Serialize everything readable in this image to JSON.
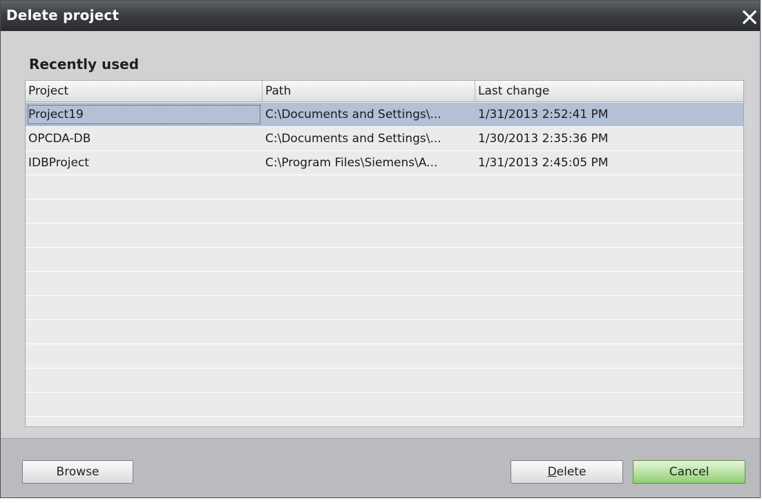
{
  "window": {
    "title": "Delete project"
  },
  "section": {
    "title": "Recently used"
  },
  "table": {
    "columns": [
      "Project",
      "Path",
      "Last change"
    ],
    "rows": [
      {
        "project": "Project19",
        "path": "C:\\Documents and Settings\\...",
        "last_change": "1/31/2013 2:52:41 PM",
        "selected": true
      },
      {
        "project": "OPCDA-DB",
        "path": "C:\\Documents and Settings\\...",
        "last_change": "1/30/2013 2:35:36 PM",
        "selected": false
      },
      {
        "project": "IDBProject",
        "path": "C:\\Program Files\\Siemens\\A...",
        "last_change": "1/31/2013 2:45:05 PM",
        "selected": false
      }
    ]
  },
  "buttons": {
    "browse": "Browse",
    "delete_mnemonic": "D",
    "delete_rest": "elete",
    "cancel": "Cancel"
  },
  "icons": {
    "close": "close-icon"
  },
  "colors": {
    "selection": "#b3c0d6",
    "cancel_accent": "#8fce6e",
    "titlebar": "#3c3f42"
  }
}
